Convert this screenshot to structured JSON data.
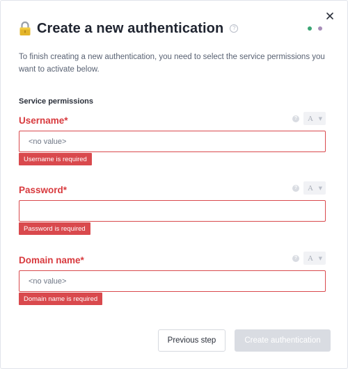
{
  "dialog": {
    "title": "Create a new authentication",
    "help_glyph": "?",
    "close_icon": "close-icon",
    "lock_icon": "lock-icon",
    "steps": [
      {
        "state": "current",
        "color": "#3aa574"
      },
      {
        "state": "upcoming",
        "color": "#a78db8"
      }
    ],
    "intro": "To finish creating a new authentication, you need to select the service permissions you want to activate below."
  },
  "section": {
    "heading": "Service permissions"
  },
  "fields": [
    {
      "label": "Username*",
      "value": "<no value>",
      "error": "Username is required",
      "type_glyph": "A",
      "help_glyph": "?"
    },
    {
      "label": "Password*",
      "value": "",
      "error": "Password is required",
      "type_glyph": "A",
      "help_glyph": "?"
    },
    {
      "label": "Domain name*",
      "value": "<no value>",
      "error": "Domain name is required",
      "type_glyph": "A",
      "help_glyph": "?"
    }
  ],
  "footer": {
    "previous_label": "Previous step",
    "create_label": "Create authentication"
  },
  "colors": {
    "error": "#d9494d",
    "step_current": "#3aa574",
    "step_upcoming": "#a78db8",
    "disabled_button": "#d9dce2"
  }
}
